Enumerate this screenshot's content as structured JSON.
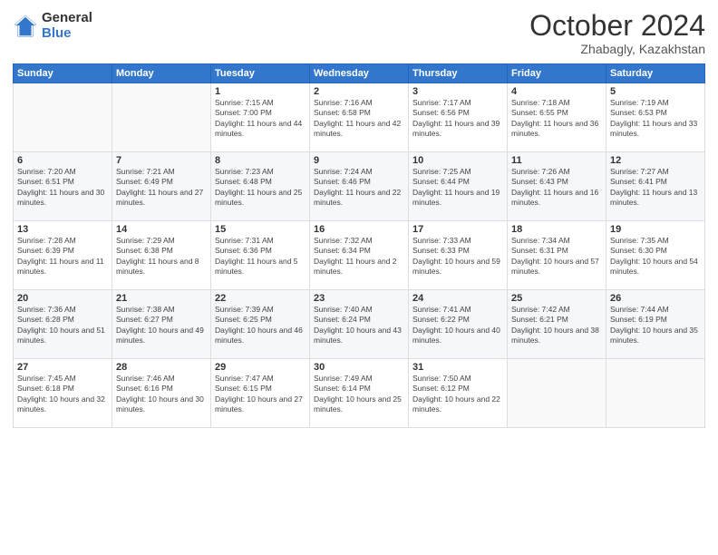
{
  "logo": {
    "general": "General",
    "blue": "Blue"
  },
  "title": "October 2024",
  "location": "Zhabagly, Kazakhstan",
  "weekdays": [
    "Sunday",
    "Monday",
    "Tuesday",
    "Wednesday",
    "Thursday",
    "Friday",
    "Saturday"
  ],
  "weeks": [
    [
      {
        "day": "",
        "sunrise": "",
        "sunset": "",
        "daylight": ""
      },
      {
        "day": "",
        "sunrise": "",
        "sunset": "",
        "daylight": ""
      },
      {
        "day": "1",
        "sunrise": "Sunrise: 7:15 AM",
        "sunset": "Sunset: 7:00 PM",
        "daylight": "Daylight: 11 hours and 44 minutes."
      },
      {
        "day": "2",
        "sunrise": "Sunrise: 7:16 AM",
        "sunset": "Sunset: 6:58 PM",
        "daylight": "Daylight: 11 hours and 42 minutes."
      },
      {
        "day": "3",
        "sunrise": "Sunrise: 7:17 AM",
        "sunset": "Sunset: 6:56 PM",
        "daylight": "Daylight: 11 hours and 39 minutes."
      },
      {
        "day": "4",
        "sunrise": "Sunrise: 7:18 AM",
        "sunset": "Sunset: 6:55 PM",
        "daylight": "Daylight: 11 hours and 36 minutes."
      },
      {
        "day": "5",
        "sunrise": "Sunrise: 7:19 AM",
        "sunset": "Sunset: 6:53 PM",
        "daylight": "Daylight: 11 hours and 33 minutes."
      }
    ],
    [
      {
        "day": "6",
        "sunrise": "Sunrise: 7:20 AM",
        "sunset": "Sunset: 6:51 PM",
        "daylight": "Daylight: 11 hours and 30 minutes."
      },
      {
        "day": "7",
        "sunrise": "Sunrise: 7:21 AM",
        "sunset": "Sunset: 6:49 PM",
        "daylight": "Daylight: 11 hours and 27 minutes."
      },
      {
        "day": "8",
        "sunrise": "Sunrise: 7:23 AM",
        "sunset": "Sunset: 6:48 PM",
        "daylight": "Daylight: 11 hours and 25 minutes."
      },
      {
        "day": "9",
        "sunrise": "Sunrise: 7:24 AM",
        "sunset": "Sunset: 6:46 PM",
        "daylight": "Daylight: 11 hours and 22 minutes."
      },
      {
        "day": "10",
        "sunrise": "Sunrise: 7:25 AM",
        "sunset": "Sunset: 6:44 PM",
        "daylight": "Daylight: 11 hours and 19 minutes."
      },
      {
        "day": "11",
        "sunrise": "Sunrise: 7:26 AM",
        "sunset": "Sunset: 6:43 PM",
        "daylight": "Daylight: 11 hours and 16 minutes."
      },
      {
        "day": "12",
        "sunrise": "Sunrise: 7:27 AM",
        "sunset": "Sunset: 6:41 PM",
        "daylight": "Daylight: 11 hours and 13 minutes."
      }
    ],
    [
      {
        "day": "13",
        "sunrise": "Sunrise: 7:28 AM",
        "sunset": "Sunset: 6:39 PM",
        "daylight": "Daylight: 11 hours and 11 minutes."
      },
      {
        "day": "14",
        "sunrise": "Sunrise: 7:29 AM",
        "sunset": "Sunset: 6:38 PM",
        "daylight": "Daylight: 11 hours and 8 minutes."
      },
      {
        "day": "15",
        "sunrise": "Sunrise: 7:31 AM",
        "sunset": "Sunset: 6:36 PM",
        "daylight": "Daylight: 11 hours and 5 minutes."
      },
      {
        "day": "16",
        "sunrise": "Sunrise: 7:32 AM",
        "sunset": "Sunset: 6:34 PM",
        "daylight": "Daylight: 11 hours and 2 minutes."
      },
      {
        "day": "17",
        "sunrise": "Sunrise: 7:33 AM",
        "sunset": "Sunset: 6:33 PM",
        "daylight": "Daylight: 10 hours and 59 minutes."
      },
      {
        "day": "18",
        "sunrise": "Sunrise: 7:34 AM",
        "sunset": "Sunset: 6:31 PM",
        "daylight": "Daylight: 10 hours and 57 minutes."
      },
      {
        "day": "19",
        "sunrise": "Sunrise: 7:35 AM",
        "sunset": "Sunset: 6:30 PM",
        "daylight": "Daylight: 10 hours and 54 minutes."
      }
    ],
    [
      {
        "day": "20",
        "sunrise": "Sunrise: 7:36 AM",
        "sunset": "Sunset: 6:28 PM",
        "daylight": "Daylight: 10 hours and 51 minutes."
      },
      {
        "day": "21",
        "sunrise": "Sunrise: 7:38 AM",
        "sunset": "Sunset: 6:27 PM",
        "daylight": "Daylight: 10 hours and 49 minutes."
      },
      {
        "day": "22",
        "sunrise": "Sunrise: 7:39 AM",
        "sunset": "Sunset: 6:25 PM",
        "daylight": "Daylight: 10 hours and 46 minutes."
      },
      {
        "day": "23",
        "sunrise": "Sunrise: 7:40 AM",
        "sunset": "Sunset: 6:24 PM",
        "daylight": "Daylight: 10 hours and 43 minutes."
      },
      {
        "day": "24",
        "sunrise": "Sunrise: 7:41 AM",
        "sunset": "Sunset: 6:22 PM",
        "daylight": "Daylight: 10 hours and 40 minutes."
      },
      {
        "day": "25",
        "sunrise": "Sunrise: 7:42 AM",
        "sunset": "Sunset: 6:21 PM",
        "daylight": "Daylight: 10 hours and 38 minutes."
      },
      {
        "day": "26",
        "sunrise": "Sunrise: 7:44 AM",
        "sunset": "Sunset: 6:19 PM",
        "daylight": "Daylight: 10 hours and 35 minutes."
      }
    ],
    [
      {
        "day": "27",
        "sunrise": "Sunrise: 7:45 AM",
        "sunset": "Sunset: 6:18 PM",
        "daylight": "Daylight: 10 hours and 32 minutes."
      },
      {
        "day": "28",
        "sunrise": "Sunrise: 7:46 AM",
        "sunset": "Sunset: 6:16 PM",
        "daylight": "Daylight: 10 hours and 30 minutes."
      },
      {
        "day": "29",
        "sunrise": "Sunrise: 7:47 AM",
        "sunset": "Sunset: 6:15 PM",
        "daylight": "Daylight: 10 hours and 27 minutes."
      },
      {
        "day": "30",
        "sunrise": "Sunrise: 7:49 AM",
        "sunset": "Sunset: 6:14 PM",
        "daylight": "Daylight: 10 hours and 25 minutes."
      },
      {
        "day": "31",
        "sunrise": "Sunrise: 7:50 AM",
        "sunset": "Sunset: 6:12 PM",
        "daylight": "Daylight: 10 hours and 22 minutes."
      },
      {
        "day": "",
        "sunrise": "",
        "sunset": "",
        "daylight": ""
      },
      {
        "day": "",
        "sunrise": "",
        "sunset": "",
        "daylight": ""
      }
    ]
  ]
}
